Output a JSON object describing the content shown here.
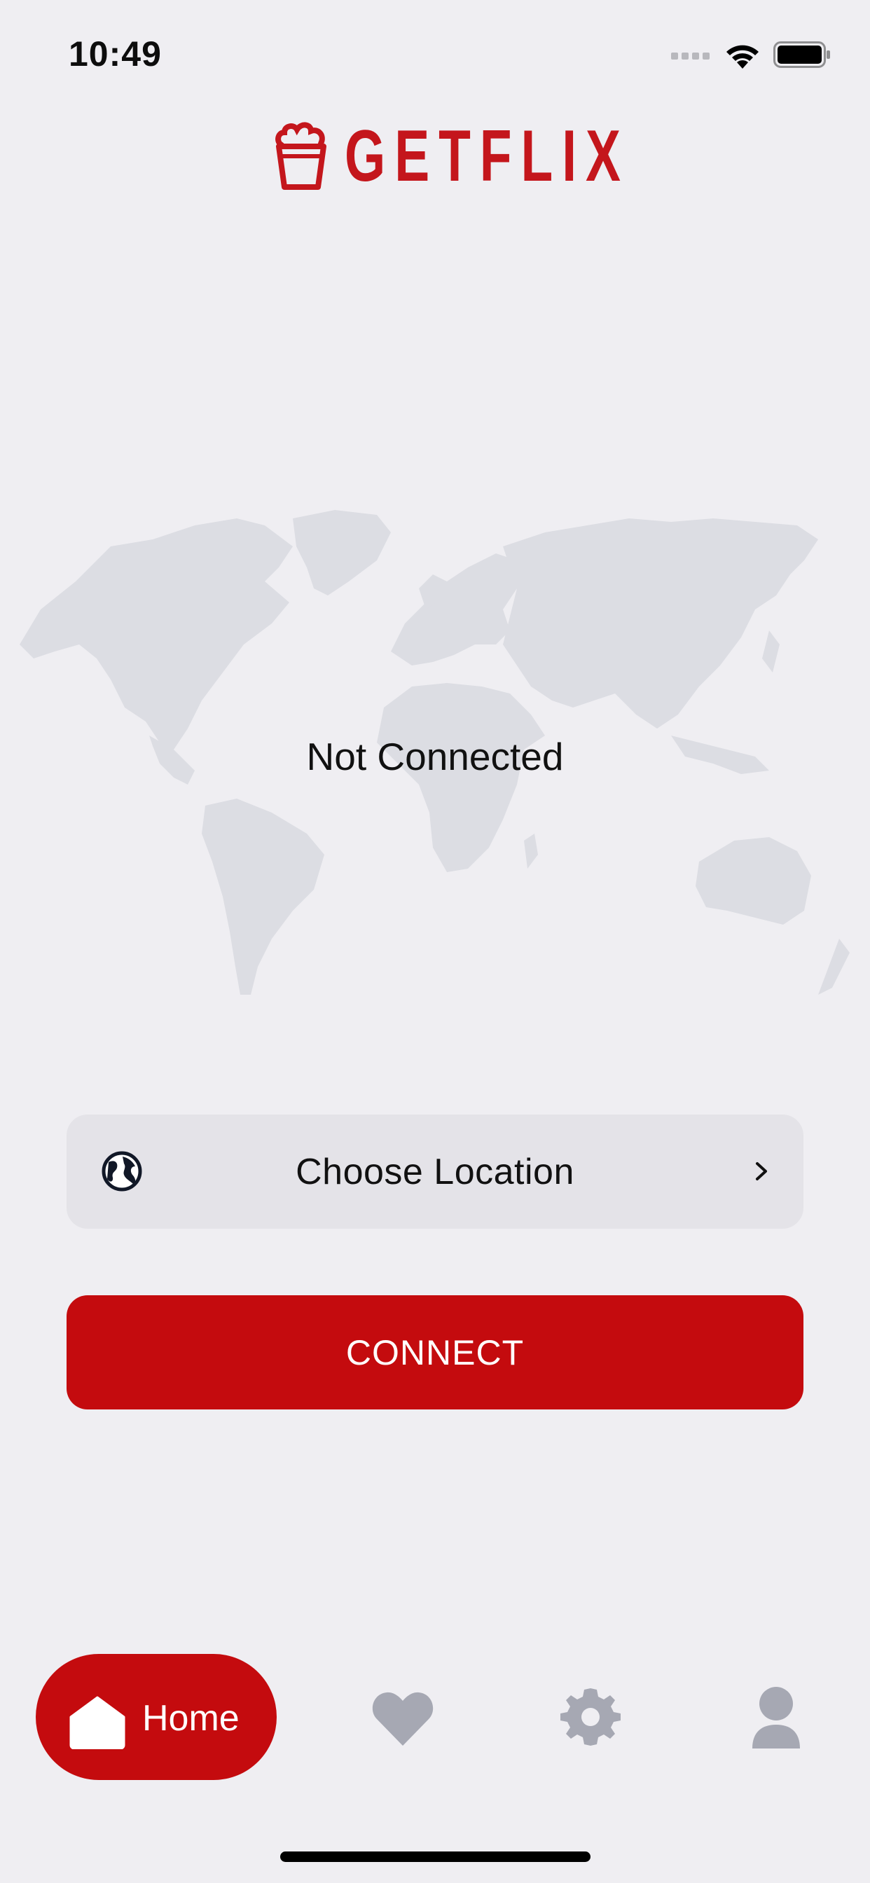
{
  "status_bar": {
    "time": "10:49"
  },
  "brand": {
    "name": "GETFLIX",
    "color": "#c4161c"
  },
  "main": {
    "connection_status": "Not Connected",
    "location_button_label": "Choose Location",
    "connect_button_label": "CONNECT"
  },
  "bottom_nav": {
    "items": [
      {
        "label": "Home",
        "icon": "home-icon",
        "active": true
      },
      {
        "label": "",
        "icon": "heart-icon",
        "active": false
      },
      {
        "label": "",
        "icon": "gear-icon",
        "active": false
      },
      {
        "label": "",
        "icon": "user-icon",
        "active": false
      }
    ]
  },
  "colors": {
    "accent": "#c40b0e",
    "background": "#efeef2",
    "map": "#dcdde3",
    "inactive_icon": "#a6a8b3"
  }
}
